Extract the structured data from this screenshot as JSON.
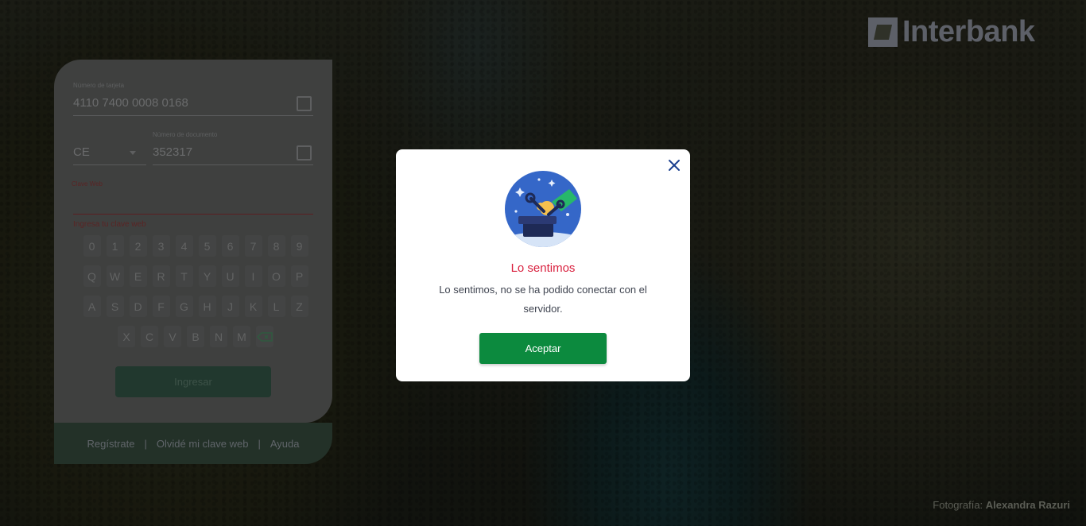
{
  "brand": {
    "name": "Interbank"
  },
  "photo_credit": {
    "prefix": "Fotografía:",
    "author": "Alexandra Razuri"
  },
  "login": {
    "card_label": "Número de tarjeta",
    "card_value": "4110 7400 0008 0168",
    "doc_type_value": "CE",
    "doc_label": "Número de documento",
    "doc_value": "352317",
    "password_label": "Clave Web",
    "password_hint": "Ingresa tu clave web",
    "keypad_rows": [
      [
        "0",
        "1",
        "2",
        "3",
        "4",
        "5",
        "6",
        "7",
        "8",
        "9"
      ],
      [
        "Q",
        "W",
        "E",
        "R",
        "T",
        "Y",
        "U",
        "I",
        "O",
        "P"
      ],
      [
        "A",
        "S",
        "D",
        "F",
        "G",
        "H",
        "J",
        "K",
        "L",
        "Z"
      ],
      [
        "X",
        "C",
        "V",
        "B",
        "N",
        "M"
      ]
    ],
    "submit_label": "Ingresar"
  },
  "footer_links": {
    "register": "Regístrate",
    "forgot": "Olvidé mi clave web",
    "help": "Ayuda",
    "separator": "|"
  },
  "modal": {
    "title": "Lo sentimos",
    "message": "Lo sentimos, no se ha podido conectar con el servidor.",
    "accept_label": "Aceptar"
  },
  "colors": {
    "accent_green": "#0c8a3e",
    "error_red": "#d9213f",
    "illustration_blue": "#3567c8"
  }
}
